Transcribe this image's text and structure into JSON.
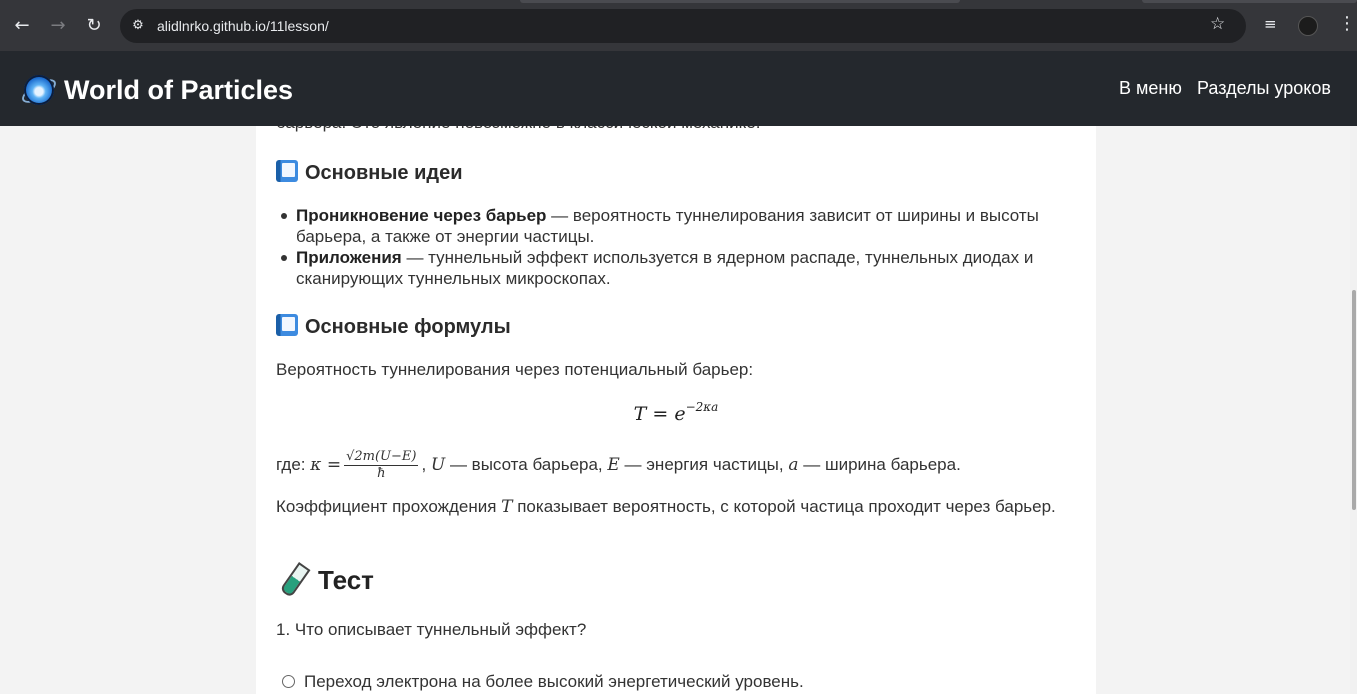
{
  "browser": {
    "url": "alidlnrko.github.io/11lesson/",
    "back_icon": "←",
    "forward_icon": "→",
    "reload_icon": "↻",
    "site_info_icon": "⚙",
    "star_icon": "☆",
    "media_icon": "≡",
    "menu_icon": "⋮"
  },
  "header": {
    "brand": "World of Particles",
    "nav": [
      "В меню",
      "Разделы уроков"
    ],
    "bg_color": "#24282d"
  },
  "content": {
    "clipped_line": "барьера. Это явление невозможно в классической механике.",
    "ideas_heading": "Основные идеи",
    "ideas": [
      {
        "term": "Проникновение через барьер",
        "text": " — вероятность туннелирования зависит от ширины и высоты барьера, а также от энергии частицы."
      },
      {
        "term": "Приложения",
        "text": " — туннельный эффект используется в ядерном распаде, туннельных диодах и сканирующих туннельных микроскопах."
      }
    ],
    "formulas_heading": "Основные формулы",
    "prob_intro": "Вероятность туннелирования через потенциальный барьер:",
    "formula_lhs": "T = e",
    "formula_exp": "−2κa",
    "where_prefix": "где: ",
    "kappa": "κ =",
    "kappa_num": "√2m(U−E)",
    "kappa_den": "ħ",
    "U": "U",
    "U_text": " — высота барьера, ",
    "E": "E",
    "E_text": " — энергия частицы, ",
    "a": "a",
    "a_text": " — ширина барьера.",
    "coef_pre": "Коэффициент прохождения ",
    "coef_T": "T",
    "coef_post": " показывает вероятность, с которой частица проходит через барьер.",
    "test_heading": "Тест",
    "question_1": "1. Что описывает туннельный эффект?",
    "option_1": "Переход электрона на более высокий энергетический уровень."
  }
}
